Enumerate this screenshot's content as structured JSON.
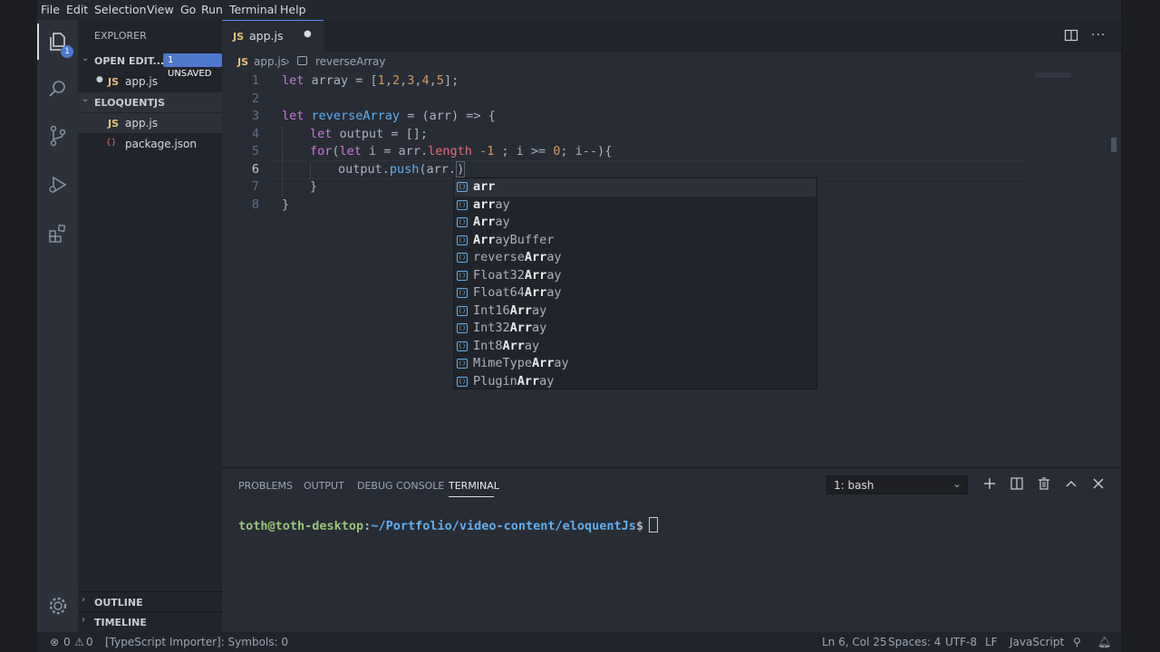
{
  "menu": [
    "File",
    "Edit",
    "Selection",
    "View",
    "Go",
    "Run",
    "Terminal",
    "Help"
  ],
  "activity_badge": "1",
  "sidebar": {
    "title": "EXPLORER",
    "open_editors": {
      "label": "OPEN EDIT...",
      "badge": "1 UNSAVED",
      "file": "app.js"
    },
    "project": {
      "label": "ELOQUENTJS",
      "files": [
        {
          "icon": "JS",
          "name": "app.js"
        },
        {
          "icon": "{}",
          "name": "package.json"
        }
      ]
    },
    "outline": "OUTLINE",
    "timeline": "TIMELINE"
  },
  "tab": {
    "icon": "JS",
    "label": "app.js",
    "dirty": "●"
  },
  "breadcrumb": {
    "icon": "JS",
    "file": "app.js",
    "symbol": "reverseArray"
  },
  "code": {
    "line_numbers": [
      "1",
      "2",
      "3",
      "4",
      "5",
      "6",
      "7",
      "8"
    ],
    "l1": {
      "a": "let",
      "b": " array = [",
      "c": "1",
      "d": ",",
      "e": "2",
      "f": ",",
      "g": "3",
      "h": ",",
      "i": "4",
      "j": ",",
      "k": "5",
      "l": "];"
    },
    "l3": {
      "a": "let",
      "b": " ",
      "c": "reverseArray",
      "d": " = (arr) => {"
    },
    "l4": {
      "a": "let",
      "b": " output = [];"
    },
    "l5": {
      "a": "for",
      "b": "(",
      "c": "let",
      "d": " i = arr.",
      "e": "length",
      "f": " -1 ",
      "g": "; i >= ",
      "h": "0",
      "i": "; i--){"
    },
    "l6": {
      "a": "output.",
      "b": "push",
      "c": "(arr.",
      "d": ")"
    },
    "l7": "}",
    "l8": "}"
  },
  "suggestions": [
    {
      "hl": "arr",
      "rest": "",
      "pre": ""
    },
    {
      "hl": "arr",
      "rest": "ay",
      "pre": ""
    },
    {
      "hl": "Arr",
      "rest": "ay",
      "pre": ""
    },
    {
      "hl": "Arr",
      "rest": "ayBuffer",
      "pre": ""
    },
    {
      "pre": "reverse",
      "hl": "Arr",
      "rest": "ay"
    },
    {
      "pre": "Float32",
      "hl": "Arr",
      "rest": "ay"
    },
    {
      "pre": "Float64",
      "hl": "Arr",
      "rest": "ay"
    },
    {
      "pre": "Int16",
      "hl": "Arr",
      "rest": "ay"
    },
    {
      "pre": "Int32",
      "hl": "Arr",
      "rest": "ay"
    },
    {
      "pre": "Int8",
      "hl": "Arr",
      "rest": "ay"
    },
    {
      "pre": "MimeType",
      "hl": "Arr",
      "rest": "ay"
    },
    {
      "pre": "Plugin",
      "hl": "Arr",
      "rest": "ay"
    }
  ],
  "panel": {
    "tabs": [
      "PROBLEMS",
      "OUTPUT",
      "DEBUG CONSOLE",
      "TERMINAL"
    ],
    "shell_select": "1: bash",
    "prompt_user": "toth@toth-desktop",
    "prompt_sep": ":",
    "prompt_path": "~/Portfolio/video-content/eloquentJs",
    "prompt_end": "$"
  },
  "status": {
    "errors": "0",
    "warnings": "0",
    "importer": "[TypeScript Importer]: Symbols: 0",
    "position": "Ln 6, Col 25",
    "spaces": "Spaces: 4",
    "encoding": "UTF-8",
    "eol": "LF",
    "language": "JavaScript"
  },
  "colors": {
    "accent": "#568af2",
    "badge": "#4d78cc",
    "keyword": "#c678dd",
    "function": "#61afef",
    "number": "#d19a66",
    "prompt_user": "#98c379",
    "prompt_path": "#61afef"
  }
}
